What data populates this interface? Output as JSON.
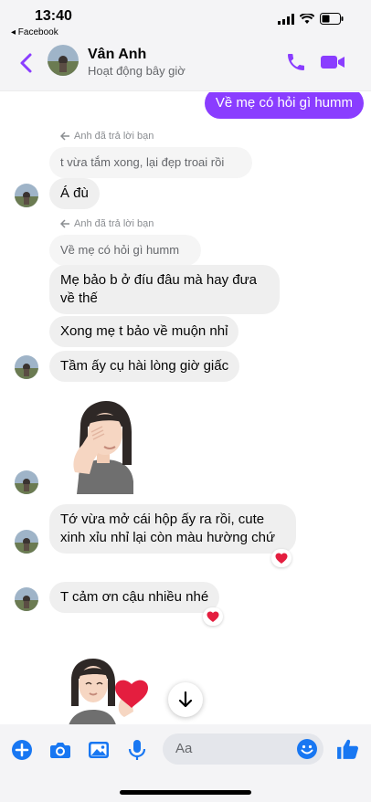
{
  "status_bar": {
    "time": "13:40",
    "back_app": "◂ Facebook"
  },
  "header": {
    "contact_name": "Vân Anh",
    "contact_status": "Hoạt động bây giờ"
  },
  "messages": {
    "out1": "Về mẹ có hỏi gì humm",
    "reply1_label": "Anh đã trả lời bạn",
    "reply1_quote": "t vừa tắm xong, lại đẹp troai rồi",
    "reply1_text": "Á đù",
    "reply2_label": "Anh đã trả lời bạn",
    "reply2_quote": "Về mẹ có hỏi gì humm",
    "msg1": "Mẹ bảo b ở đíu đâu mà hay đưa về thế",
    "msg2": "Xong mẹ t bảo về muộn nhỉ",
    "msg3": "Tầm ấy cụ hài lòng giờ giấc",
    "msg4": "Tớ vừa mở cái hộp ấy ra rồi, cute xinh xỉu nhỉ lại còn màu hường chứ",
    "msg5": "T cảm ơn cậu nhiều nhé"
  },
  "reactions": {
    "msg4": "❤️",
    "msg5": "❤️"
  },
  "composer": {
    "placeholder": "Aa"
  },
  "colors": {
    "accent": "#8a3dff",
    "incoming_bubble": "#efefef",
    "reaction_heart": "#e41e3f"
  },
  "icons": [
    "back-chevron",
    "phone",
    "video-camera",
    "reply-arrow",
    "plus",
    "camera",
    "image",
    "microphone",
    "emoji",
    "thumbs-up",
    "arrow-down"
  ]
}
